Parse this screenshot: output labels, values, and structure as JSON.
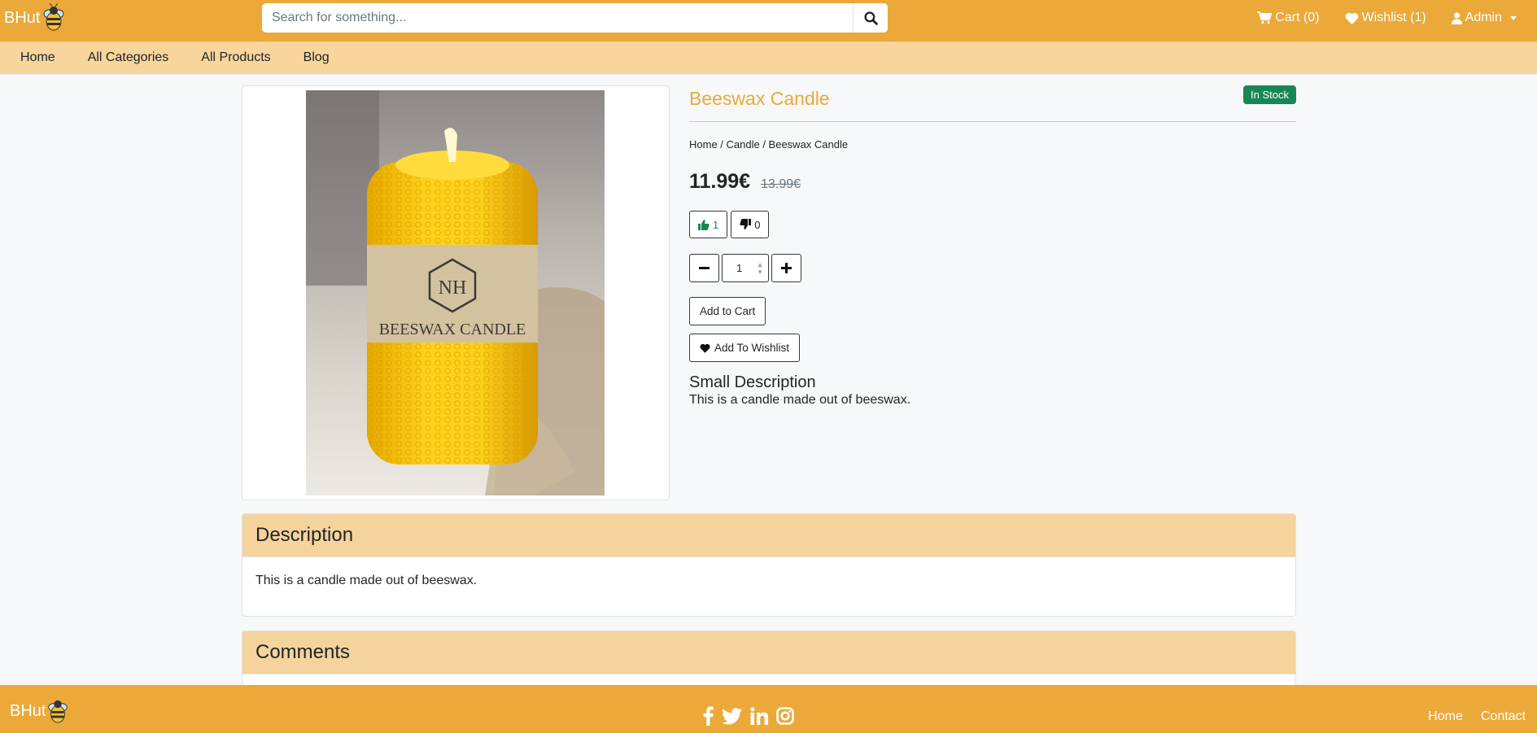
{
  "header": {
    "brand": "BHut",
    "search_placeholder": "Search for something...",
    "cart_label": "Cart (0)",
    "wishlist_label": "Wishlist (1)",
    "user_label": "Admin"
  },
  "nav": [
    "Home",
    "All Categories",
    "All Products",
    "Blog"
  ],
  "product": {
    "title": "Beeswax Candle",
    "stock_badge": "In Stock",
    "breadcrumb": "Home / Candle / Beeswax Candle",
    "price": "11.99€",
    "old_price": "13.99€",
    "likes": "1",
    "dislikes": "0",
    "quantity": "1",
    "add_to_cart": "Add to Cart",
    "add_to_wishlist": "Add To Wishlist",
    "small_description_title": "Small Description",
    "small_description": "This is a candle made out of beeswax.",
    "image_label_text": "BEESWAX CANDLE"
  },
  "description": {
    "title": "Description",
    "text": "This is a candle made out of beeswax."
  },
  "comments": {
    "title": "Comments"
  },
  "footer": {
    "brand": "BHut",
    "links": [
      "Home",
      "Contact"
    ],
    "social_icons": [
      "facebook-icon",
      "twitter-icon",
      "linkedin-icon",
      "instagram-icon"
    ]
  },
  "colors": {
    "primary": "#eba93a",
    "subnav": "#f7d59c",
    "card_header": "#f4d39c",
    "success": "#198754",
    "background": "#f7f8fa"
  }
}
